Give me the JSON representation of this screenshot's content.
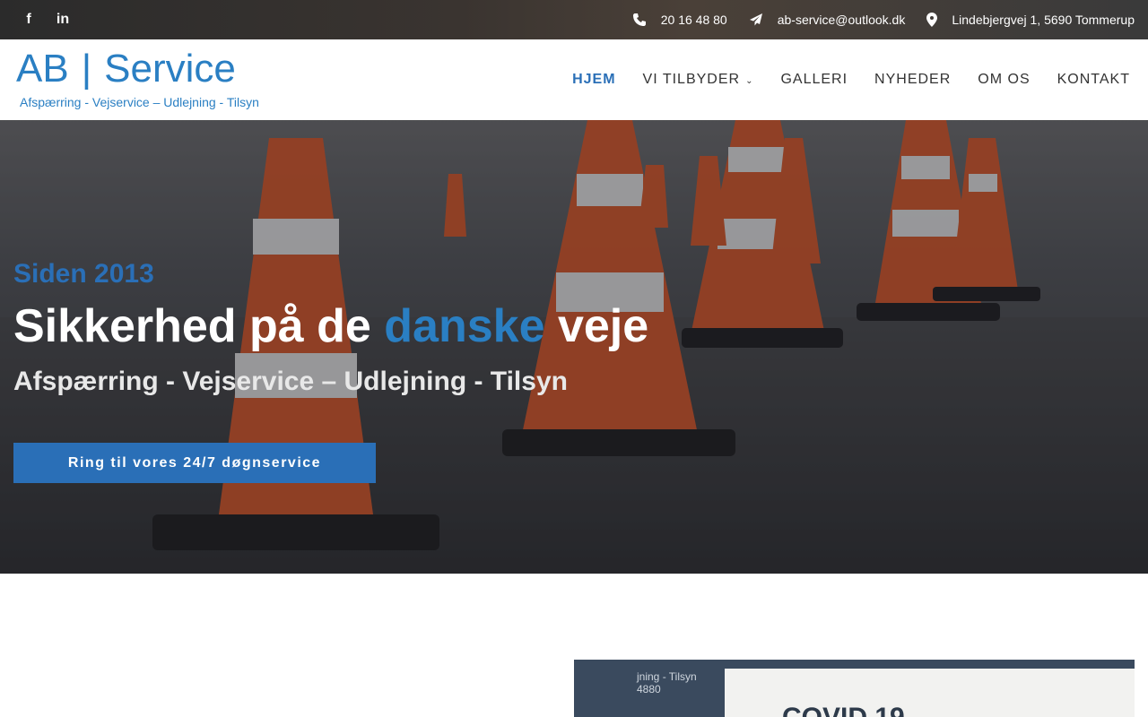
{
  "topbar": {
    "social": [
      {
        "name": "facebook-icon",
        "glyph": "f"
      },
      {
        "name": "linkedin-icon",
        "glyph": "in"
      }
    ],
    "phone": "20 16 48 80",
    "email": "ab-service@outlook.dk",
    "address": "Lindebjergvej 1, 5690 Tommerup"
  },
  "header": {
    "logo_left": "AB",
    "logo_bar": "|",
    "logo_right": "Service",
    "logo_tagline": "Afspærring - Vejservice – Udlejning - Tilsyn",
    "nav": [
      {
        "label": "HJEM",
        "active": true
      },
      {
        "label": "VI TILBYDER",
        "dropdown": true
      },
      {
        "label": "GALLERI"
      },
      {
        "label": "NYHEDER"
      },
      {
        "label": "OM OS"
      },
      {
        "label": "KONTAKT"
      }
    ]
  },
  "hero": {
    "since": "Siden 2013",
    "headline_before": "Sikkerhed på de ",
    "headline_accent": "danske",
    "headline_after": " veje",
    "subline": "Afspærring - Vejservice – Udlejning - Tilsyn",
    "cta": "Ring til vores 24/7 døgnservice"
  },
  "preview": {
    "tag_text": "jning - Tilsyn",
    "tag_num": "4880",
    "sign_text": "COVID 19"
  },
  "colors": {
    "brand_blue": "#2a6fb7",
    "logo_blue": "#2a7fc3",
    "cone_orange": "#d9582a"
  }
}
